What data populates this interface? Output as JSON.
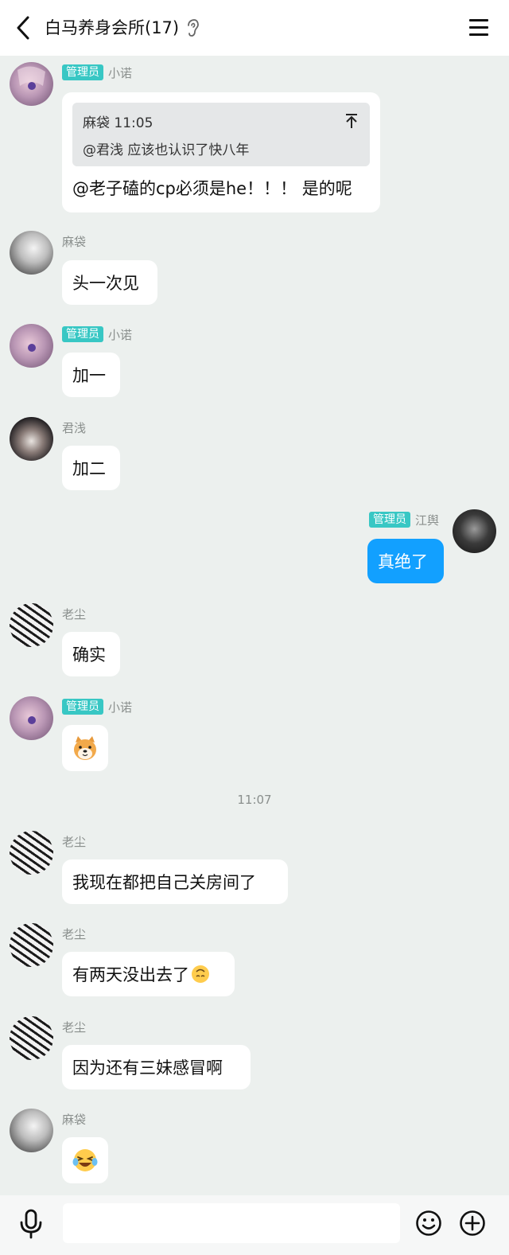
{
  "header": {
    "title": "白马养身会所(17)",
    "back_icon": "chevron-left-icon",
    "ear_icon": "ear-icon",
    "menu_icon": "hamburger-menu-icon"
  },
  "roles": {
    "admin": "管理员"
  },
  "messages": [
    {
      "sender": "小诺",
      "admin": true,
      "quote_header": "麻袋 11:05",
      "quote_text": "@君浅 应该也认识了快八年",
      "text": "@老子磕的cp必须是he！！！ 是的呢"
    },
    {
      "sender": "麻袋",
      "admin": false,
      "text": "头一次见"
    },
    {
      "sender": "小诺",
      "admin": true,
      "text": "加一"
    },
    {
      "sender": "君浅",
      "admin": false,
      "text": "加二"
    },
    {
      "sender": "江舆",
      "admin": true,
      "text": "真绝了",
      "mine": true
    },
    {
      "sender": "老尘",
      "admin": false,
      "text": "确实"
    },
    {
      "sender": "小诺",
      "admin": true,
      "emoji": "doge-dog-emoji"
    },
    {
      "timestamp": "11:07"
    },
    {
      "sender": "老尘",
      "admin": false,
      "text": "我现在都把自己关房间了"
    },
    {
      "sender": "老尘",
      "admin": false,
      "text": "有两天没出去了",
      "trailing_emoji": "upside-down-face-emoji"
    },
    {
      "sender": "老尘",
      "admin": false,
      "text": "因为还有三妹感冒啊"
    },
    {
      "sender": "麻袋",
      "admin": false,
      "emoji": "laughing-tears-emoji"
    }
  ],
  "input": {
    "mic_icon": "microphone-icon",
    "emoji_icon": "smiley-icon",
    "plus_icon": "plus-circle-icon",
    "placeholder": ""
  },
  "colors": {
    "background": "#ecf0ee",
    "admin_badge": "#38c7c4",
    "my_bubble": "#12a0ff"
  }
}
